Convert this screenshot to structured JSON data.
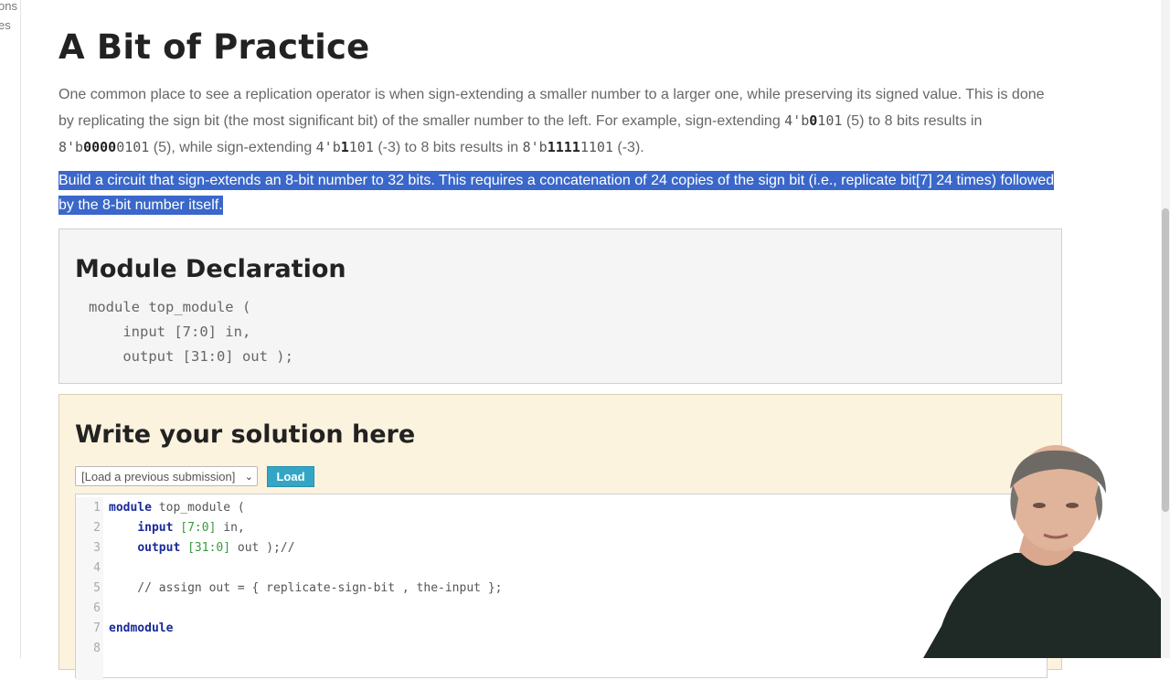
{
  "sidebar_fragments": [
    "ons",
    "es"
  ],
  "page": {
    "title": "A Bit of Practice",
    "intro_text_1": "One common place to see a replication operator is when sign-extending a smaller number to a larger one, while preserving its signed value. This is done by replicating the sign bit (the most significant bit) of the smaller number to the left. For example, sign-extending ",
    "ex1_prefix": "4'b",
    "ex1_bold": "0",
    "ex1_rest": "101",
    "intro_text_2": " (5) to 8 bits results in ",
    "ex2_prefix": "8'b",
    "ex2_bold": "0000",
    "ex2_rest": "0101",
    "intro_text_3": " (5), while sign-extending ",
    "ex3_prefix": "4'b",
    "ex3_bold": "1",
    "ex3_rest": "101",
    "intro_text_4": " (-3) to 8 bits results in ",
    "ex4_prefix": "8'b",
    "ex4_bold": "1111",
    "ex4_rest": "1101",
    "intro_text_5": " (-3).",
    "task_text": "Build a circuit that sign-extends an 8-bit number to 32 bits. This requires a concatenation of 24 copies of the sign bit (i.e., replicate bit[7] 24 times) followed by the 8-bit number itself."
  },
  "module_declaration": {
    "title": "Module Declaration",
    "code": "module top_module (\n    input [7:0] in,\n    output [31:0] out );"
  },
  "solution": {
    "title": "Write your solution here",
    "select_value": "[Load a previous submission]",
    "load_label": "Load",
    "lines": [
      {
        "num": "1",
        "kw": "module",
        "rest": " top_module ("
      },
      {
        "num": "2",
        "pre": "    ",
        "kw": "input",
        "bracket": " [7:0]",
        "rest": " in,"
      },
      {
        "num": "3",
        "pre": "    ",
        "kw": "output",
        "bracket": " [31:0]",
        "rest": " out );//"
      },
      {
        "num": "4",
        "rest": ""
      },
      {
        "num": "5",
        "comment": "    // assign out = { replicate-sign-bit , the-input };"
      },
      {
        "num": "6",
        "rest": ""
      },
      {
        "num": "7",
        "kw": "endmodule",
        "rest": ""
      },
      {
        "num": "8",
        "rest": ""
      }
    ]
  }
}
